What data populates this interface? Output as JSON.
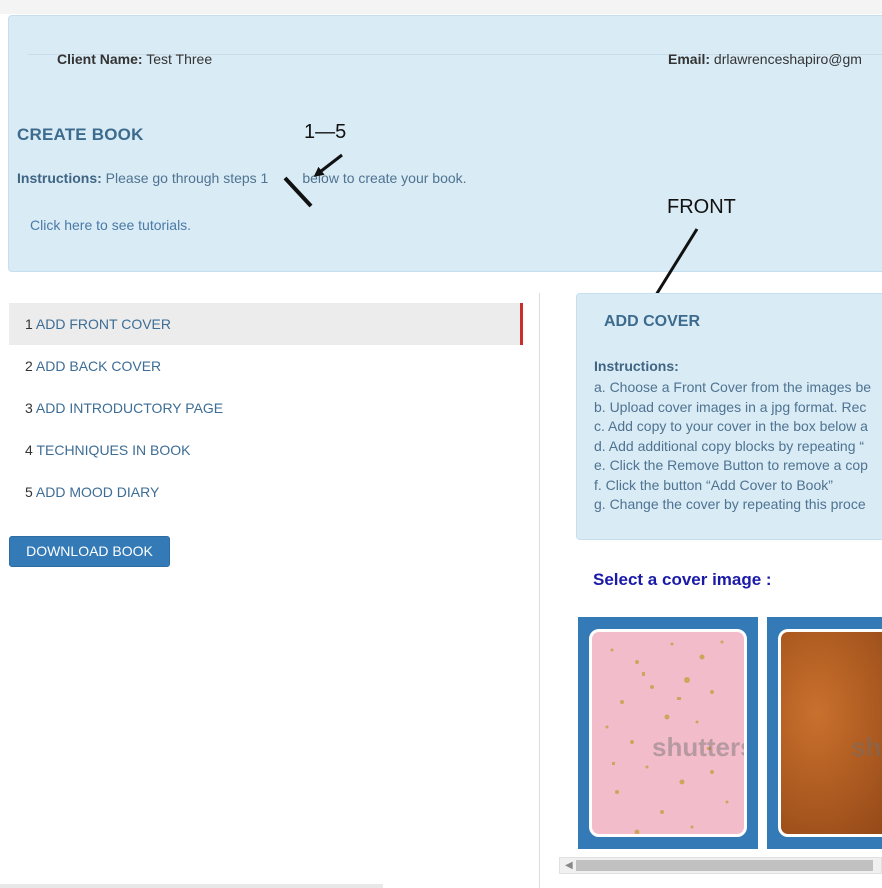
{
  "header": {
    "client_label": "Client Name:",
    "client_value": " Test Three",
    "email_label": "Email:",
    "email_value": " drlawrenceshapiro@gm",
    "create_title": "CREATE BOOK",
    "instructions_label": "Instructions:",
    "instructions_text_a": " Please go through steps 1",
    "instructions_text_b": "below to create your book.",
    "tutorial_link": "Click here to see tutorials."
  },
  "annotations": {
    "range_label": "1—5",
    "front_label": "FRONT"
  },
  "sidebar": {
    "items": [
      {
        "num": "1",
        "label": "ADD FRONT COVER"
      },
      {
        "num": "2",
        "label": "ADD BACK COVER"
      },
      {
        "num": "3",
        "label": "ADD INTRODUCTORY PAGE"
      },
      {
        "num": "4",
        "label": "TECHNIQUES IN BOOK"
      },
      {
        "num": "5",
        "label": "ADD MOOD DIARY"
      }
    ],
    "active_index": 0,
    "download_label": "DOWNLOAD BOOK"
  },
  "cover": {
    "title": "ADD COVER",
    "instructions_label": "Instructions:",
    "steps": [
      "a. Choose a Front Cover from the images be",
      "b. Upload cover images in a jpg format. Rec",
      "c. Add copy to your cover in the box below a",
      "d. Add additional copy blocks by repeating “",
      "e. Click the Remove Button to remove a cop",
      "f. Click the button “Add Cover to Book”",
      "g. Change the cover by repeating this proce"
    ],
    "select_heading": "Select a cover image :",
    "thumbnails": [
      {
        "watermark": "shutters"
      },
      {
        "watermark": "sh"
      }
    ]
  },
  "colors": {
    "panel_bg": "#d9ebf5",
    "primary": "#337ab7",
    "active_marker": "#c9302c",
    "heading_blue": "#3d6b8e",
    "select_heading": "#1a1aa8"
  }
}
